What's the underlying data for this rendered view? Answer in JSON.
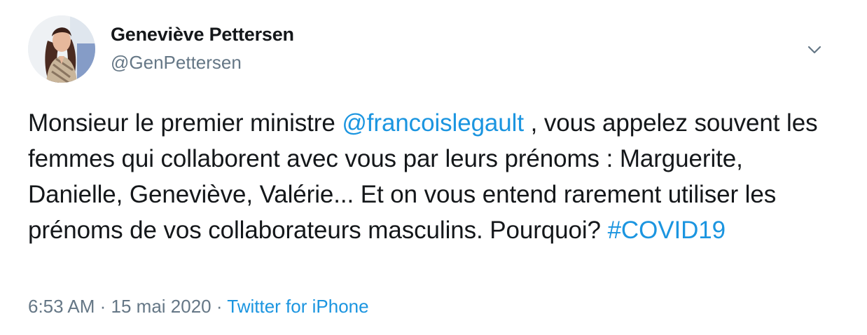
{
  "author": {
    "display_name": "Geneviève Pettersen",
    "handle": "@GenPettersen",
    "avatar_icon": "profile-photo"
  },
  "tweet": {
    "text_before_mention": "Monsieur le premier ministre ",
    "mention": "@francoislegault",
    "text_after_mention": " , vous appelez souvent les femmes qui collaborent avec vous par leurs prénoms : Marguerite, Danielle, Geneviève, Valérie... Et on vous entend rarement utiliser les prénoms de vos collaborateurs masculins. Pourquoi? ",
    "hashtag": "#COVID19"
  },
  "meta": {
    "time": "6:53 AM",
    "separator": " · ",
    "date": "15 mai 2020",
    "source": "Twitter for iPhone"
  },
  "menu": {
    "icon": "chevron-down-icon"
  },
  "colors": {
    "link": "#1b95e0",
    "text": "#14171a",
    "muted": "#657786"
  }
}
